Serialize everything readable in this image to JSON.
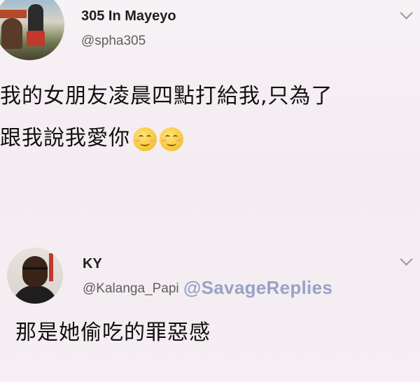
{
  "tweets": [
    {
      "name": "305 In Mayeyo",
      "handle": "@spha305",
      "text_line1": "我的女朋友凌晨四點打給我,只為了",
      "text_line2": "跟我說我愛你",
      "emojis": [
        "smiling-face-icon",
        "smiling-face-icon"
      ]
    },
    {
      "name": "KY",
      "handle": "@Kalanga_Papi",
      "text_line1": "那是她偷吃的罪惡感"
    }
  ],
  "watermark": "@SavageReplies",
  "colors": {
    "background": "#f5eff3",
    "name": "#1f1f1f",
    "handle": "#5e5e5e",
    "watermark": "#8d9bc2"
  }
}
